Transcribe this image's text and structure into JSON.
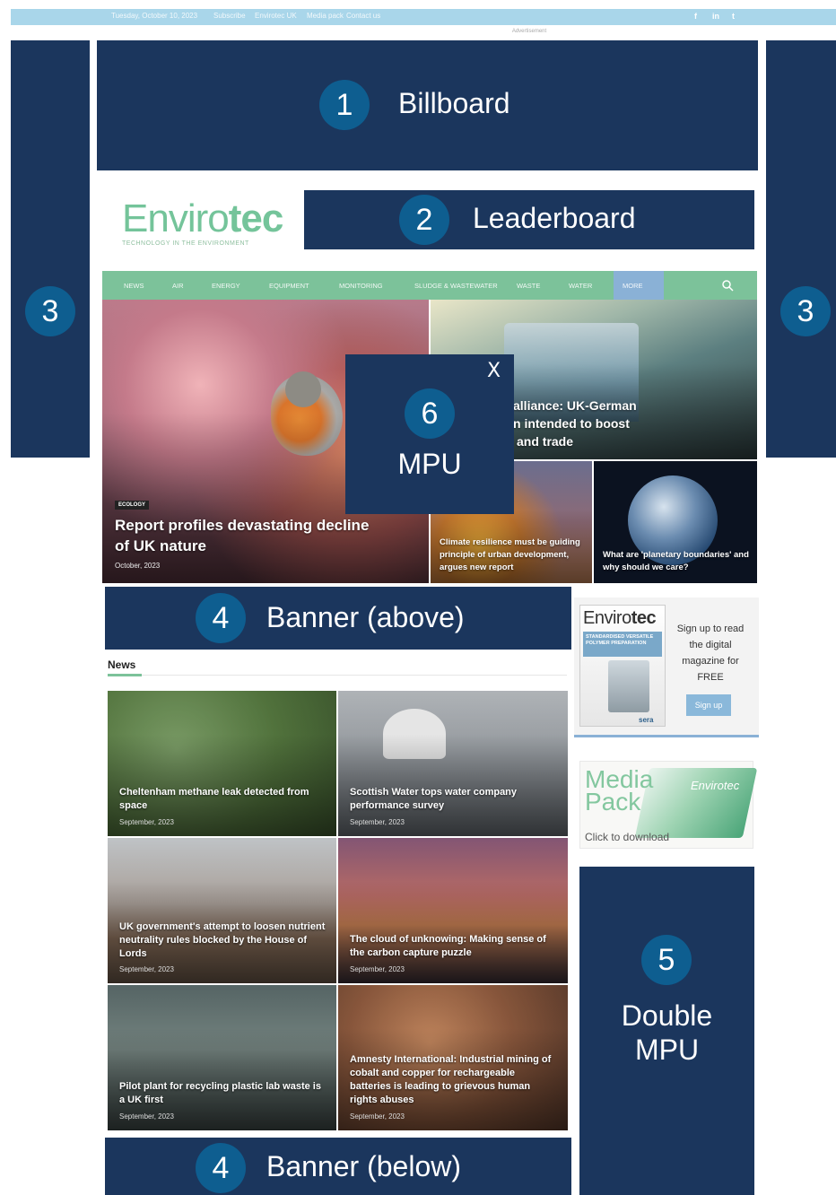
{
  "topbar": {
    "date_text": "Tuesday, October 10, 2023",
    "links": [
      "Subscribe",
      "Envirotec UK",
      "Media pack",
      "Contact us"
    ],
    "social": [
      "f",
      "in",
      "t"
    ]
  },
  "advertisement_label": "Advertisement",
  "logo": {
    "text_light": "Enviro",
    "text_bold": "tec",
    "tagline": "TECHNOLOGY IN THE ENVIRONMENT"
  },
  "nav": {
    "items": [
      "NEWS",
      "AIR",
      "ENERGY",
      "EQUIPMENT",
      "MONITORING",
      "SLUDGE & WASTEWATER",
      "WASTE",
      "WATER",
      "MORE"
    ]
  },
  "hero": {
    "left": {
      "category": "ECOLOGY",
      "title": "Report profiles devastating decline of UK nature",
      "date": "October, 2023"
    },
    "top_right": {
      "title": "Alliance: UK-German … intended to boost … and trade",
      "title_lines": [
        "alliance: UK-German",
        "n intended to boost",
        "and trade"
      ]
    },
    "bottom_mid": {
      "title": "Climate resilience must be guiding principle of urban development, argues new report"
    },
    "bottom_right": {
      "title": "What are 'planetary boundaries' and why should we care?"
    }
  },
  "news": {
    "heading": "News",
    "cards": [
      {
        "title": "Cheltenham methane leak detected from space",
        "date": "September, 2023"
      },
      {
        "title": "Scottish Water tops water company performance survey",
        "date": "September, 2023"
      },
      {
        "title": "UK government's attempt to loosen nutrient neutrality rules blocked by the House of Lords",
        "date": "September, 2023"
      },
      {
        "title": "The cloud of unknowing: Making sense of the carbon capture puzzle",
        "date": "September, 2023"
      },
      {
        "title": "Pilot plant for recycling plastic lab waste is a UK first",
        "date": "September, 2023"
      },
      {
        "title": "Amnesty International: Industrial mining of cobalt and copper for rechargeable batteries is leading to grievous human rights abuses",
        "date": "September, 2023"
      }
    ]
  },
  "sidebar": {
    "magazine": {
      "cover_title_light": "Enviro",
      "cover_title_bold": "tec",
      "cover_band": "STANDARDISED VERSATILE POLYMER PREPARATION",
      "cover_footer": "sera",
      "signup_text": "Sign up to read the digital magazine for FREE",
      "signup_button": "Sign up"
    },
    "media_pack": {
      "title_line1": "Media",
      "title_line2": "Pack",
      "brand": "Envirotec",
      "cta": "Click to download"
    }
  },
  "ad_slots": {
    "billboard": {
      "number": "1",
      "label": "Billboard"
    },
    "leaderboard": {
      "number": "2",
      "label": "Leaderboard"
    },
    "skin_left": {
      "number": "3"
    },
    "skin_right": {
      "number": "3"
    },
    "banner_above": {
      "number": "4",
      "label": "Banner (above)"
    },
    "banner_below": {
      "number": "4",
      "label": "Banner (below)"
    },
    "double_mpu": {
      "number": "5",
      "label_line1": "Double",
      "label_line2": "MPU"
    },
    "mpu": {
      "number": "6",
      "label": "MPU",
      "close": "X"
    }
  },
  "colors": {
    "ad_fill": "#1b365d",
    "circle": "#0e5e90",
    "nav_green": "#7cc29a",
    "topbar": "#a9d6ea"
  }
}
